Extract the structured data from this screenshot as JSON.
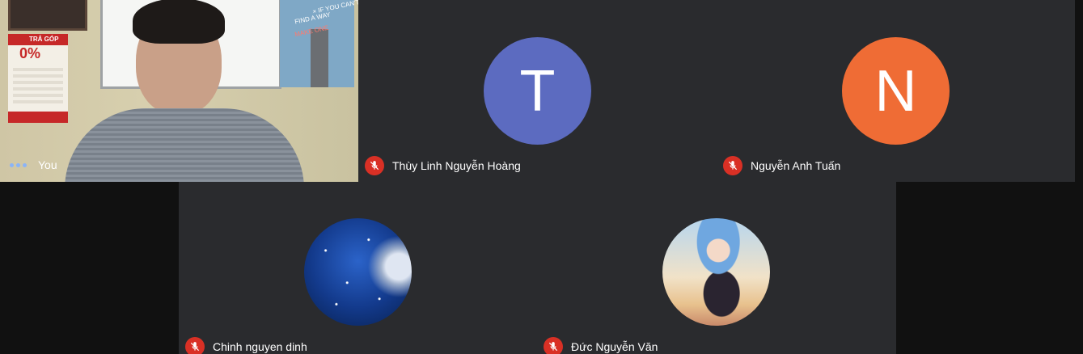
{
  "participants": {
    "self": {
      "name": "You"
    },
    "p1": {
      "name": "Thùy Linh Nguyễn Hoàng",
      "initial": "T",
      "color": "#5c6bc0"
    },
    "p2": {
      "name": "Nguyễn Anh Tuấn",
      "initial": "N",
      "color": "#ef6c35"
    },
    "p3": {
      "name": "Chinh nguyen dinh",
      "avatar_type": "starry-moon-photo"
    },
    "p4": {
      "name": "Đức Nguyễn Văn",
      "avatar_type": "anime-character-photo"
    }
  },
  "self_view_background": {
    "poster_text_lines": [
      "× IF YOU CAN'T",
      "FIND A WAY",
      "MAKE ONE"
    ],
    "calendar_text": [
      "TRẢ GÓP",
      "0%"
    ]
  },
  "icons": {
    "mute": "microphone-off-icon",
    "speaking": "speaking-dots-icon"
  }
}
